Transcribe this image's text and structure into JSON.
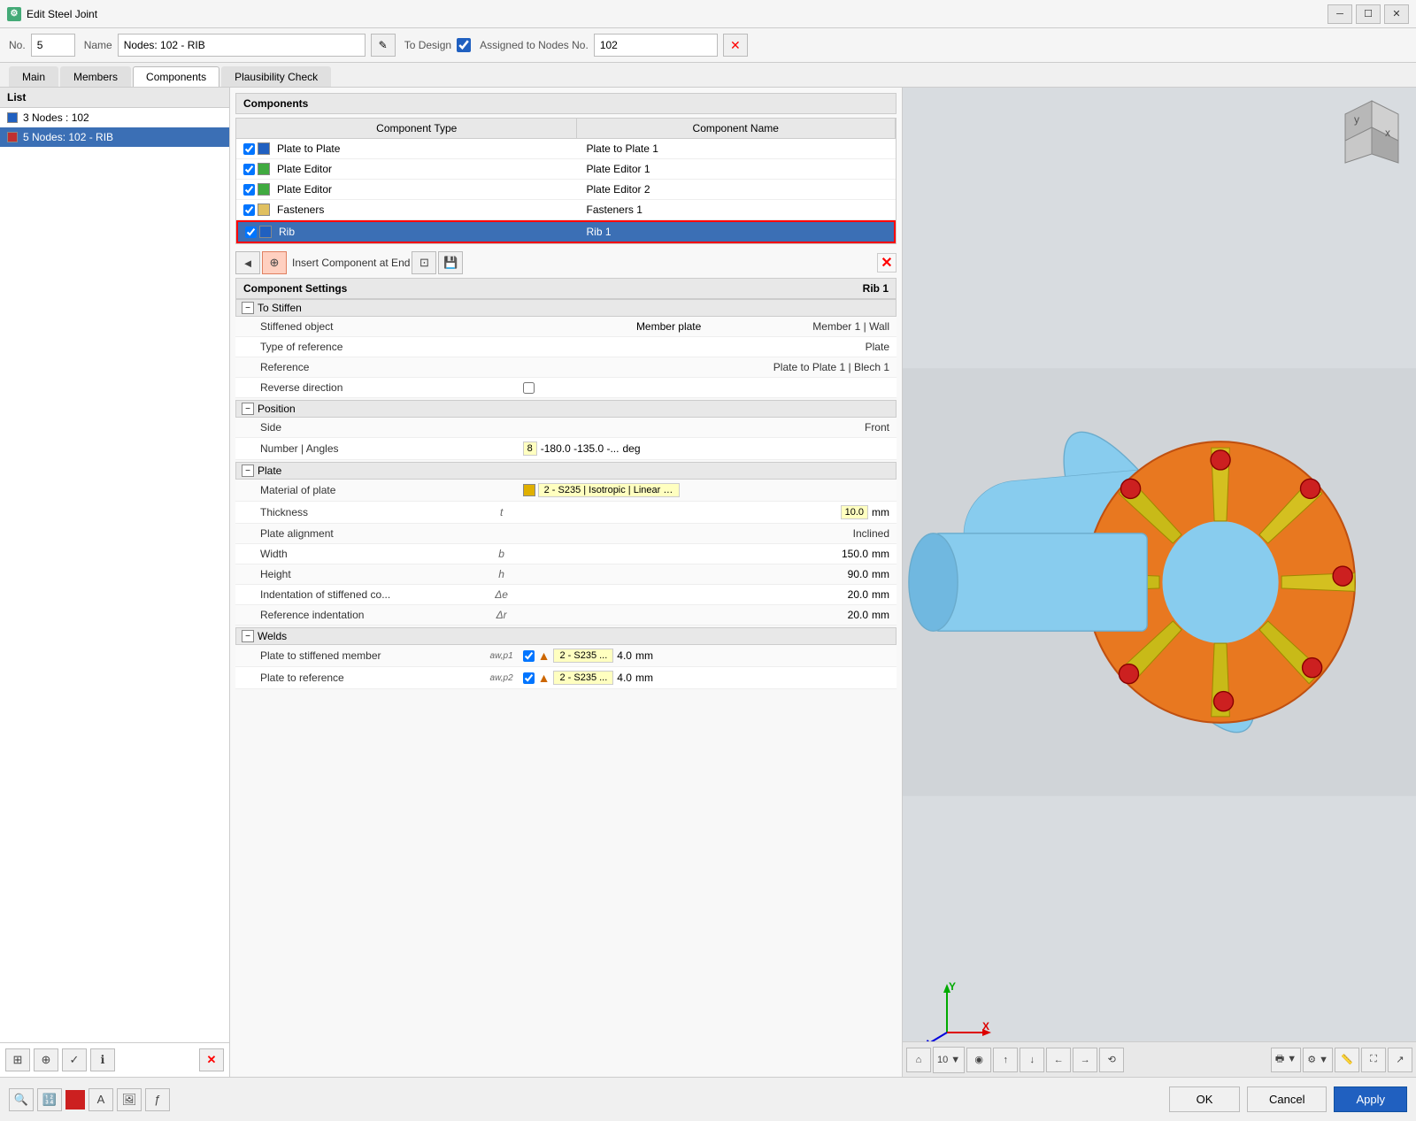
{
  "window": {
    "title": "Edit Steel Joint",
    "icon": "⚙"
  },
  "header": {
    "no_label": "No.",
    "no_value": "5",
    "name_label": "Name",
    "name_value": "Nodes: 102 - RIB",
    "to_design_label": "To Design",
    "assigned_label": "Assigned to Nodes No.",
    "assigned_value": "102"
  },
  "tabs": {
    "items": [
      "Main",
      "Members",
      "Components",
      "Plausibility Check"
    ],
    "active": 2
  },
  "list": {
    "title": "List",
    "items": [
      {
        "label": "3 Nodes : 102",
        "color": "#2060c0",
        "selected": false
      },
      {
        "label": "5 Nodes: 102 - RIB",
        "color": "#c03030",
        "selected": true
      }
    ]
  },
  "components": {
    "title": "Components",
    "columns": [
      "Component Type",
      "Component Name"
    ],
    "rows": [
      {
        "checked": true,
        "color": "#2060c0",
        "type": "Plate to Plate",
        "name": "Plate to Plate 1",
        "selected": false
      },
      {
        "checked": true,
        "color": "#40aa40",
        "type": "Plate Editor",
        "name": "Plate Editor 1",
        "selected": false
      },
      {
        "checked": true,
        "color": "#40aa40",
        "type": "Plate Editor",
        "name": "Plate Editor 2",
        "selected": false
      },
      {
        "checked": true,
        "color": "#e0c060",
        "type": "Fasteners",
        "name": "Fasteners 1",
        "selected": false
      },
      {
        "checked": true,
        "color": "#2060c0",
        "type": "Rib",
        "name": "Rib 1",
        "selected": true
      }
    ],
    "toolbar": {
      "insert_label": "Insert Component at End",
      "buttons": [
        "⊞",
        "⊕",
        "⊝",
        "↑",
        "↓"
      ]
    }
  },
  "settings": {
    "title": "Component Settings",
    "component_name": "Rib 1",
    "groups": [
      {
        "name": "To Stiffen",
        "collapsed": false,
        "rows": [
          {
            "name": "Stiffened object",
            "symbol": "",
            "value": "Member plate",
            "extra": "Member 1 | Wall",
            "unit": ""
          },
          {
            "name": "Type of reference",
            "symbol": "",
            "value": "Plate",
            "unit": ""
          },
          {
            "name": "Reference",
            "symbol": "",
            "value": "Plate to Plate 1 | Blech 1",
            "unit": ""
          },
          {
            "name": "Reverse direction",
            "symbol": "",
            "value": "checkbox_false",
            "unit": ""
          }
        ]
      },
      {
        "name": "Position",
        "collapsed": false,
        "rows": [
          {
            "name": "Side",
            "symbol": "",
            "value": "Front",
            "unit": ""
          },
          {
            "name": "Number | Angles",
            "symbol": "",
            "value": "8",
            "extra": "-180.0 -135.0 -...",
            "unit": "deg"
          }
        ]
      },
      {
        "name": "Plate",
        "collapsed": false,
        "rows": [
          {
            "name": "Material of plate",
            "symbol": "",
            "value": "2 - S235 | Isotropic | Linear Elast...",
            "material": true,
            "unit": ""
          },
          {
            "name": "Thickness",
            "symbol": "t",
            "value": "10.0",
            "unit": "mm"
          },
          {
            "name": "Plate alignment",
            "symbol": "",
            "value": "Inclined",
            "unit": ""
          },
          {
            "name": "Width",
            "symbol": "b",
            "value": "150.0",
            "unit": "mm"
          },
          {
            "name": "Height",
            "symbol": "h",
            "value": "90.0",
            "unit": "mm"
          },
          {
            "name": "Indentation of stiffened co...",
            "symbol": "Δe",
            "value": "20.0",
            "unit": "mm"
          },
          {
            "name": "Reference indentation",
            "symbol": "Δr",
            "value": "20.0",
            "unit": "mm"
          }
        ]
      },
      {
        "name": "Welds",
        "collapsed": false,
        "rows": [
          {
            "name": "Plate to stiffened member",
            "symbol": "aw,p1",
            "weld": true,
            "value": "4.0",
            "unit": "mm",
            "mat": "2 - S235 ..."
          },
          {
            "name": "Plate to reference",
            "symbol": "aw,p2",
            "weld": true,
            "value": "4.0",
            "unit": "mm",
            "mat": "2 - S235 ..."
          }
        ]
      }
    ]
  },
  "bottom_buttons": {
    "ok": "OK",
    "cancel": "Cancel",
    "apply": "Apply"
  },
  "view": {
    "zoom_level": "10"
  }
}
